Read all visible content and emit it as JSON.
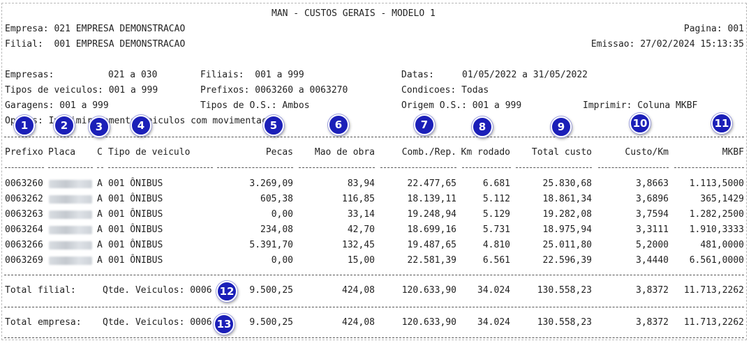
{
  "report": {
    "title": "MAN - CUSTOS GERAIS - MODELO 1",
    "empresa": "Empresa: 021 EMPRESA DEMONSTRACAO",
    "filial": "Filial:  001 EMPRESA DEMONSTRACAO",
    "pagina": "Pagina: 001",
    "emissao": "Emissao: 27/02/2024 15:13:35"
  },
  "filters": {
    "empresas_label": "Empresas:",
    "empresas_value": "021 a 030",
    "filiais": "Filiais:  001 a 999",
    "datas_label": "Datas:",
    "datas_value": "01/05/2022 a 31/05/2022",
    "tipos_veiculos": "Tipos de veiculos: 001 a 999",
    "prefixos": "Prefixos: 0063260 a 0063270",
    "condicoes": "Condicoes: Todas",
    "garagens": "Garagens: 001 a 999",
    "tipos_os": "Tipos de O.S.: Ambos",
    "origem_os": "Origem O.S.: 001 a 999",
    "imprimir": "Imprimir: Coluna MKBF",
    "opcoes": "Opcoes: Imprimir somente veiculos com movimentacao"
  },
  "columns": {
    "prefixo": "Prefixo",
    "placa": "Placa",
    "c": "C",
    "tipo": "Tipo de veiculo",
    "pecas": "Pecas",
    "mao": "Mao de obra",
    "comb": "Comb./Rep.",
    "km": "Km rodado",
    "total": "Total custo",
    "custokm": "Custo/Km",
    "mkbf": "MKBF"
  },
  "rows": [
    {
      "prefixo": "0063260",
      "c": "A",
      "tipo": "001 ÔNIBUS",
      "pecas": "3.269,09",
      "mao": "83,94",
      "comb": "22.477,65",
      "km": "6.681",
      "total": "25.830,68",
      "custokm": "3,8663",
      "mkbf": "1.113,5000"
    },
    {
      "prefixo": "0063262",
      "c": "A",
      "tipo": "001 ÔNIBUS",
      "pecas": "605,38",
      "mao": "116,85",
      "comb": "18.139,11",
      "km": "5.112",
      "total": "18.861,34",
      "custokm": "3,6896",
      "mkbf": "365,1429"
    },
    {
      "prefixo": "0063263",
      "c": "A",
      "tipo": "001 ÔNIBUS",
      "pecas": "0,00",
      "mao": "33,14",
      "comb": "19.248,94",
      "km": "5.129",
      "total": "19.282,08",
      "custokm": "3,7594",
      "mkbf": "1.282,2500"
    },
    {
      "prefixo": "0063264",
      "c": "A",
      "tipo": "001 ÔNIBUS",
      "pecas": "234,08",
      "mao": "42,70",
      "comb": "18.699,16",
      "km": "5.731",
      "total": "18.975,94",
      "custokm": "3,3111",
      "mkbf": "1.910,3333"
    },
    {
      "prefixo": "0063266",
      "c": "A",
      "tipo": "001 ÔNIBUS",
      "pecas": "5.391,70",
      "mao": "132,45",
      "comb": "19.487,65",
      "km": "4.810",
      "total": "25.011,80",
      "custokm": "5,2000",
      "mkbf": "481,0000"
    },
    {
      "prefixo": "0063269",
      "c": "A",
      "tipo": "001 ÔNIBUS",
      "pecas": "0,00",
      "mao": "15,00",
      "comb": "22.581,39",
      "km": "6.561",
      "total": "22.596,39",
      "custokm": "3,4440",
      "mkbf": "6.561,0000"
    }
  ],
  "totals": [
    {
      "label": "Total filial:",
      "qtde": "Qtde. Veiculos: 0006",
      "pecas": "9.500,25",
      "mao": "424,08",
      "comb": "120.633,90",
      "km": "34.024",
      "total": "130.558,23",
      "custokm": "3,8372",
      "mkbf": "11.713,2262"
    },
    {
      "label": "Total empresa:",
      "qtde": "Qtde. Veiculos: 0006",
      "pecas": "9.500,25",
      "mao": "424,08",
      "comb": "120.633,90",
      "km": "34.024",
      "total": "130.558,23",
      "custokm": "3,8372",
      "mkbf": "11.713,2262"
    }
  ],
  "badges": [
    "1",
    "2",
    "3",
    "4",
    "5",
    "6",
    "7",
    "8",
    "9",
    "10",
    "11",
    "12",
    "13"
  ],
  "badge_color": "#1b1fb8"
}
